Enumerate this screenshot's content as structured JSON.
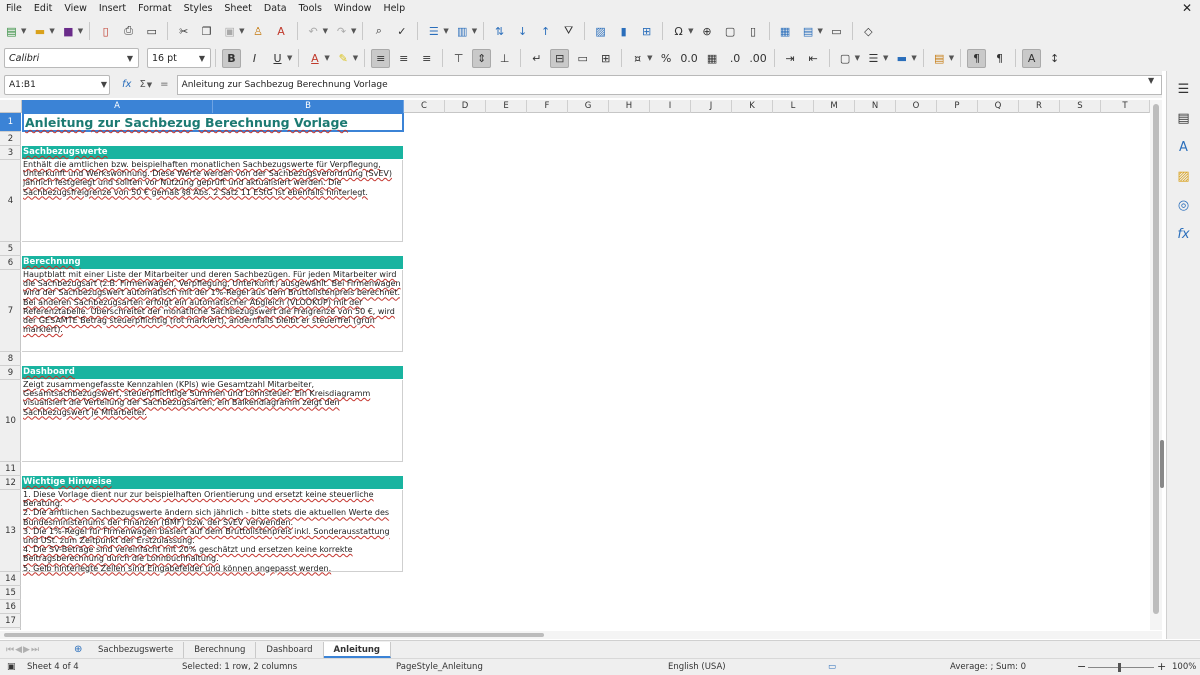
{
  "menu": [
    "File",
    "Edit",
    "View",
    "Insert",
    "Format",
    "Styles",
    "Sheet",
    "Data",
    "Tools",
    "Window",
    "Help"
  ],
  "toolbar2": {
    "font_name": "Calibri",
    "font_size": "16 pt"
  },
  "formula_bar": {
    "cell_ref": "A1:B1",
    "content": "Anleitung zur Sachbezug Berechnung Vorlage"
  },
  "columns": [
    "A",
    "B",
    "C",
    "D",
    "E",
    "F",
    "G",
    "H",
    "I",
    "J",
    "K",
    "L",
    "M",
    "N",
    "O",
    "P",
    "Q",
    "R",
    "S",
    "T"
  ],
  "rows": [
    "1",
    "2",
    "3",
    "4",
    "5",
    "6",
    "7",
    "8",
    "9",
    "10",
    "11",
    "12",
    "13",
    "14",
    "15",
    "16",
    "17"
  ],
  "sheet": {
    "title": "Anleitung zur Sachbezug Berechnung Vorlage",
    "sections": [
      {
        "header": "Sachbezugswerte",
        "body": "Enthält die amtlichen bzw. beispielhaften monatlichen Sachbezugswerte für Verpflegung, Unterkunft und Werkswohnung. Diese Werte werden von der Sachbezugsverordnung (SvEV) jährlich festgelegt und sollten vor Nutzung geprüft und aktualisiert werden. Die Sachbezugsfreigrenze von 50 € gemäß §8 Abs. 2 Satz 11 EStG ist ebenfalls hinterlegt."
      },
      {
        "header": "Berechnung",
        "body": "Hauptblatt mit einer Liste der Mitarbeiter und deren Sachbezügen. Für jeden Mitarbeiter wird die Sachbezugsart (z.B. Firmenwagen, Verpflegung, Unterkunft) ausgewählt. Bei Firmenwagen wird der Sachbezugswert automatisch mit der 1%-Regel aus dem Bruttolistenpreis berechnet. Bei anderen Sachbezugsarten erfolgt ein automatischer Abgleich (VLOOKUP) mit der Referenztabelle. Überschreitet der monatliche Sachbezugswert die Freigrenze von 50 €, wird der GESAMTE Betrag steuerpflichtig (rot markiert), andernfalls bleibt er steuerfrei (grün markiert)."
      },
      {
        "header": "Dashboard",
        "body": "Zeigt zusammengefasste Kennzahlen (KPIs) wie Gesamtzahl Mitarbeiter, Gesamtsachbezugswert, steuerpflichtige Summen und Lohnsteuer. Ein Kreisdiagramm visualisiert die Verteilung der Sachbezugsarten, ein Balkendiagramm zeigt den Sachbezugswert je Mitarbeiter."
      },
      {
        "header": "Wichtige Hinweise",
        "body": "1. Diese Vorlage dient nur zur beispielhaften Orientierung und ersetzt keine steuerliche Beratung.\n2. Die amtlichen Sachbezugswerte ändern sich jährlich - bitte stets die aktuellen Werte des Bundesministeriums der Finanzen (BMF) bzw. der SvEV verwenden.\n3. Die 1%-Regel für Firmenwagen basiert auf dem Bruttolistenpreis inkl. Sonderausstattung und USt. zum Zeitpunkt der Erstzulassung.\n4. Die SV-Beträge sind vereinfacht mit 20% geschätzt und ersetzen keine korrekte Beitragsberechnung durch die Lohnbuchhaltung.\n5. Gelb hinterlegte Zellen sind Eingabefelder und können angepasst werden."
      }
    ]
  },
  "tabs": [
    "Sachbezugswerte",
    "Berechnung",
    "Dashboard",
    "Anleitung"
  ],
  "active_tab": "Anleitung",
  "status": {
    "sheet": "Sheet 4 of 4",
    "selection": "Selected: 1 row, 2 columns",
    "page_style": "PageStyle_Anleitung",
    "language": "English (USA)",
    "summary": "Average: ; Sum: 0",
    "zoom_minus": "−",
    "zoom_plus": "+",
    "zoom": "100%"
  },
  "colors": {
    "section_header_bg": "#19b4a0",
    "title_text": "#1c7a72",
    "selection": "#3b83d6",
    "spell_underline": "#c4342d"
  }
}
